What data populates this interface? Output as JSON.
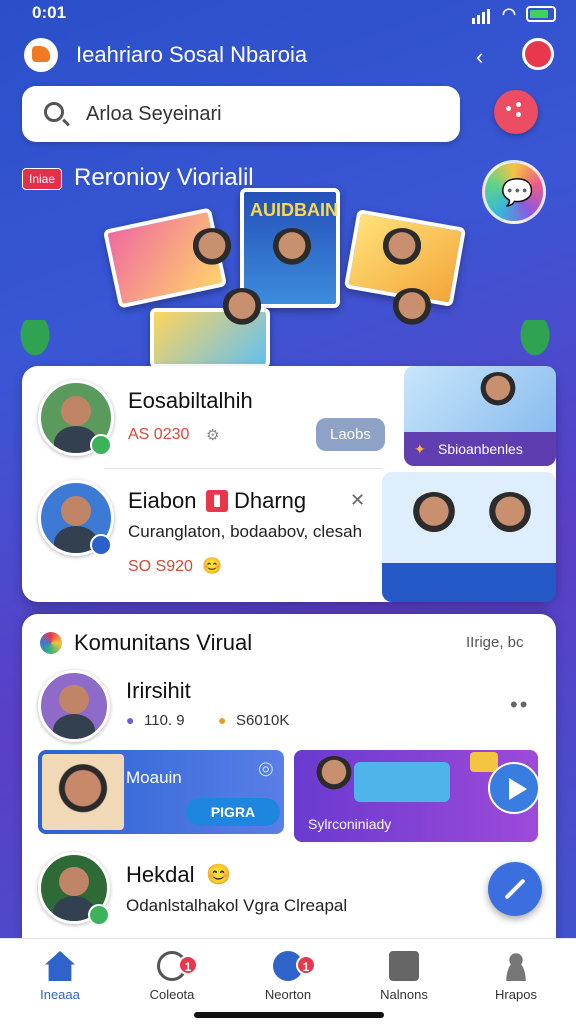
{
  "status_bar": {
    "time": "0:01"
  },
  "app_bar": {
    "title": "Ieahriaro Sosal Nbaroia"
  },
  "search": {
    "value": "Arloa Seyeinari",
    "placeholder": ""
  },
  "banner": {
    "tag": "Iniae",
    "title": "Reronioy Viorialil",
    "poster_text": "AUIDBAIN"
  },
  "featured": [
    {
      "name": "Eosabiltalhih",
      "meta": "AS 0230",
      "action_label": "Laobs",
      "thumb_caption": "Sbioanbenles"
    },
    {
      "name": "Eiabon",
      "tag_text": "Dharng",
      "description": "Curanglaton, bodaabov, clesah",
      "meta": "SO S920"
    }
  ],
  "community": {
    "title": "Komunitans Virual",
    "link": "IIrige, bc",
    "post": {
      "name": "Irirsihit",
      "stat1": "110. 9",
      "stat2": "S6010K"
    },
    "tiles": [
      {
        "title": "Moauin",
        "button": "PIGRA"
      },
      {
        "title": "Sylrconiniady"
      }
    ],
    "second_post": {
      "name": "Hekdal",
      "description": "Odanlstalhakol Vgra Clreapal"
    }
  },
  "nav": [
    {
      "label": "Ineaaa",
      "badge": ""
    },
    {
      "label": "Coleota",
      "badge": "1"
    },
    {
      "label": "Neorton",
      "badge": "1"
    },
    {
      "label": "Nalnons",
      "badge": ""
    },
    {
      "label": "Hrapos",
      "badge": ""
    }
  ],
  "colors": {
    "accent": "#2f63c9",
    "danger": "#e8374c",
    "background": "#3a56d4"
  }
}
